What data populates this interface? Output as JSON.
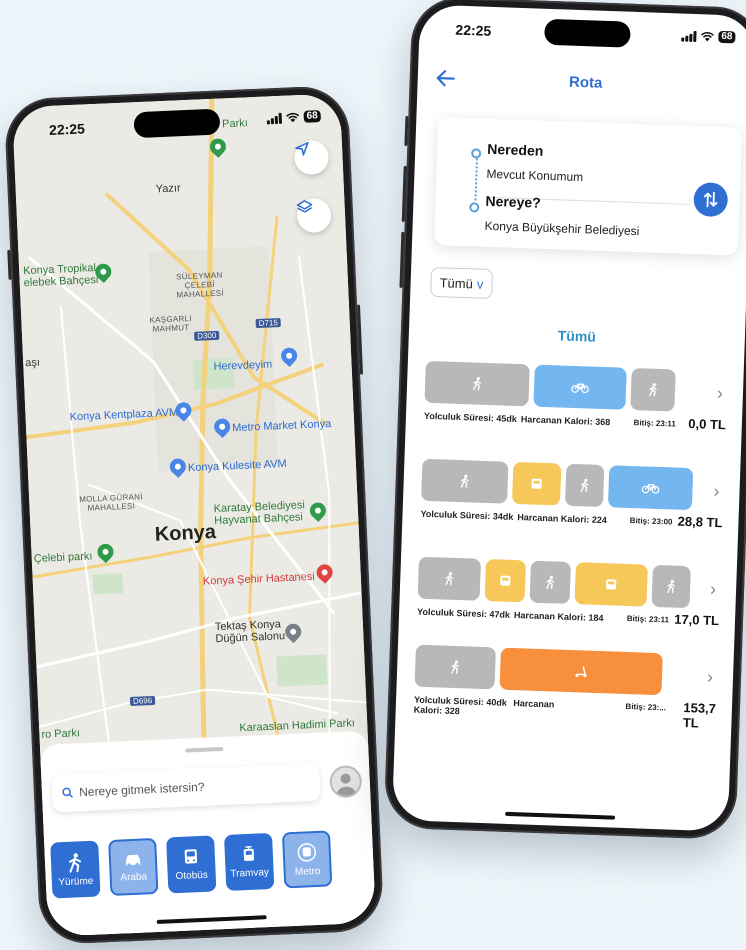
{
  "left_phone": {
    "status": {
      "time": "22:25",
      "battery": "68"
    },
    "map": {
      "labels": {
        "kyoto": "Kyoto Parkı",
        "yazir": "Yazır",
        "tropikal": "Konya Tropikal\nelebek Bahçesi",
        "suleyman": "SÜLEYMAN\nÇELEBİ\nMAHALLESİ",
        "kasgarli": "KAŞGARLI\nMAHMUT",
        "asi": "aşı",
        "herevdeyim": "Herevdeyim",
        "kentplaza": "Konya Kentplaza AVM",
        "metro_market": "Metro Market Konya",
        "kulesite": "Konya Kulesite AVM",
        "molla": "MOLLA GÜRANİ\nMAHALLESİ",
        "karatay": "Karatay Belediyesi\nHayvanat Bahçesi",
        "city": "Konya",
        "celebi": "Çelebi parkı",
        "hastane": "Konya Şehir Hastanesi",
        "tektas": "Tektaş Konya\nDüğün Salonu",
        "karaaslan": "Karaaslan Hadimi Parkı",
        "ro": "ro Parkı"
      },
      "roads": {
        "d300": "D300",
        "d715": "D715",
        "d696": "D696"
      }
    },
    "search": {
      "placeholder": "Nereye gitmek istersin?"
    },
    "modes": [
      {
        "label": "Yürüme",
        "icon": "walk-icon"
      },
      {
        "label": "Araba",
        "icon": "car-icon"
      },
      {
        "label": "Otobüs",
        "icon": "bus-icon"
      },
      {
        "label": "Tramvay",
        "icon": "tram-icon"
      },
      {
        "label": "Metro",
        "icon": "metro-icon"
      }
    ]
  },
  "right_phone": {
    "status": {
      "time": "22:25",
      "battery": "68"
    },
    "header": {
      "title": "Rota"
    },
    "route": {
      "from_label": "Nereden",
      "from_value": "Mevcut Konumum",
      "to_label": "Nereye?",
      "to_value": "Konya Büyükşehir Belediyesi"
    },
    "filter": {
      "value": "Tümü",
      "chevron": "v"
    },
    "section_title": "Tümü",
    "options": [
      {
        "duration": "Yolculuk Süresi: 45dk",
        "calories": "Harcanan Kalori: 368",
        "end": "Bitiş: 23:11",
        "price": "0,0 TL",
        "segments": [
          "walk",
          "bike",
          "walk"
        ]
      },
      {
        "duration": "Yolculuk Süresi: 34dk",
        "calories": "Harcanan Kalori: 224",
        "end": "Bitiş: 23:00",
        "price": "28,8 TL",
        "segments": [
          "walk",
          "bus",
          "walk",
          "bike"
        ]
      },
      {
        "duration": "Yolculuk Süresi: 47dk",
        "calories": "Harcanan Kalori: 184",
        "end": "Bitiş: 23:11",
        "price": "17,0 TL",
        "segments": [
          "walk",
          "bus",
          "walk",
          "bus",
          "walk"
        ]
      },
      {
        "duration": "Yolculuk Süresi: 40dk",
        "calories": "Harcanan\nKalori: 328",
        "end": "Bitiş: 23:...",
        "price": "153,7\nTL",
        "segments": [
          "walk",
          "scooter"
        ]
      }
    ],
    "colors": {
      "accent": "#2f6fd4",
      "walk": "#b8b8b8",
      "bike": "#74b6ef",
      "bus": "#f6c85a",
      "scooter": "#f78f3c"
    }
  }
}
